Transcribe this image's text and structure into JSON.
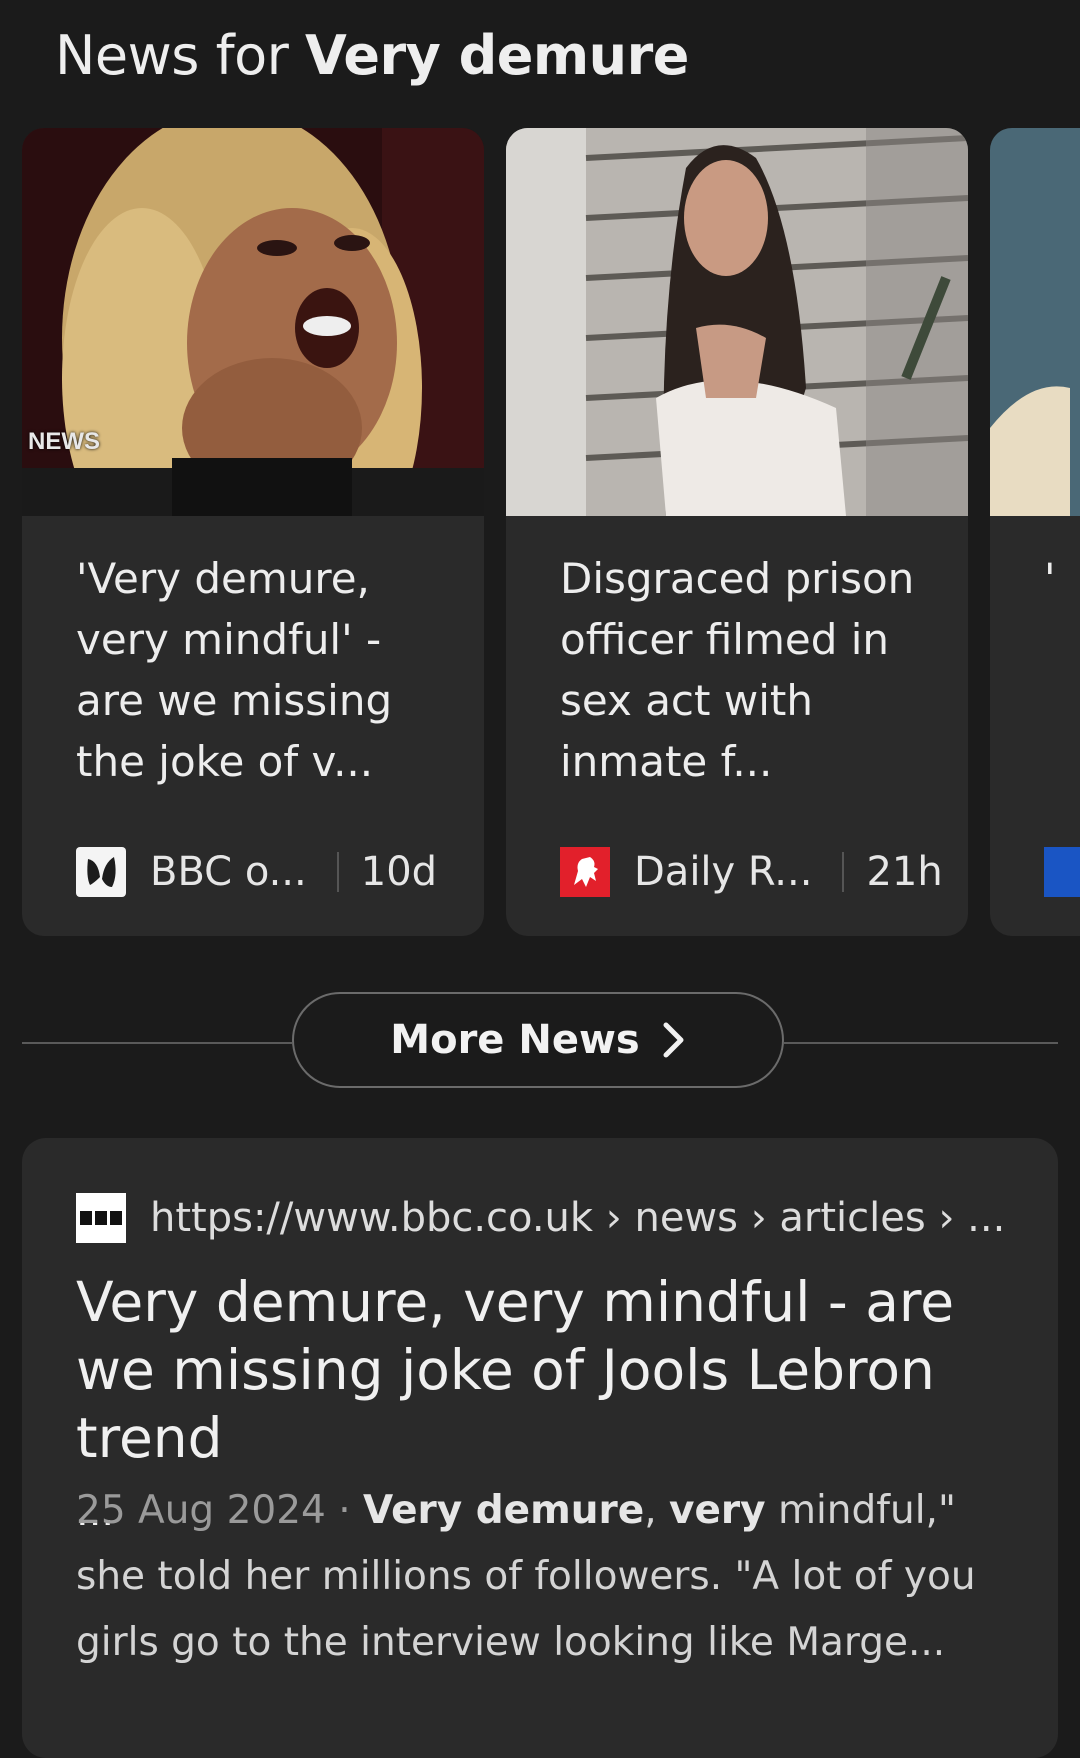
{
  "section": {
    "title_prefix": "News for ",
    "title_query": "Very demure"
  },
  "news_cards": [
    {
      "image_badge": "NEWS",
      "headline": "'Very demure, very mindful' - are we missing the joke of v...",
      "source": "BBC o...",
      "source_icon": "bbc-butterfly-icon",
      "age": "10d"
    },
    {
      "headline": "Disgraced prison officer filmed in sex act with inmate f...",
      "source": "Daily R...",
      "source_icon": "daily-record-lion-icon",
      "age": "21h"
    },
    {
      "headline_partial": "'",
      "source_icon": "partial-source-icon"
    }
  ],
  "more_news": {
    "label": "More News",
    "icon": "chevron-right-icon"
  },
  "result": {
    "favicon": "bbc-favicon-icon",
    "url": "https://www.bbc.co.uk › news › articles › ...",
    "title": "Very demure, very mindful - are we missing joke of Jools Lebron trend",
    "title_ellipsis": "...",
    "date": "25 Aug 2024",
    "date_sep": " · ",
    "snippet_bold_1": "Very demure",
    "snippet_text_1": ", ",
    "snippet_bold_2": "very",
    "snippet_text_2": " mindful,\" she told her millions of followers. \"A lot of you girls go to the interview looking like Marge..."
  },
  "colors": {
    "background": "#1b1b1b",
    "card": "#2a2a2a",
    "daily_record_red": "#e2202b",
    "partial_icon_blue": "#1a55c4"
  }
}
